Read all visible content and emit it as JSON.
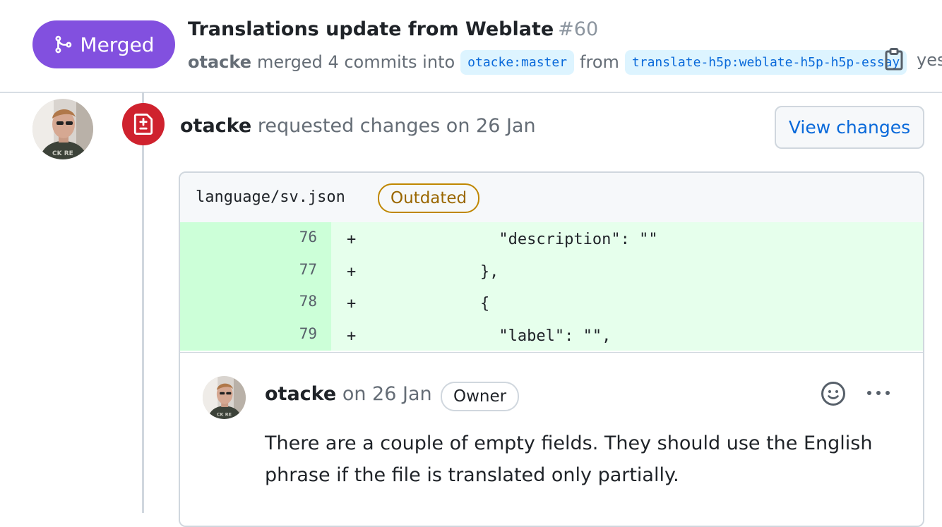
{
  "header": {
    "status_label": "Merged",
    "title": "Translations update from Weblate",
    "number": "#60",
    "merger": "otacke",
    "merged_text": "merged 4 commits into",
    "base_branch": "otacke:master",
    "from_text": "from",
    "head_branch": "translate-h5p:weblate-h5p-h5p-essay",
    "trailing_text": "yes"
  },
  "review": {
    "author": "otacke",
    "action": "requested changes on 26 Jan",
    "view_changes_label": "View changes"
  },
  "file": {
    "name": "language/sv.json",
    "badge": "Outdated",
    "lines": [
      {
        "num": "76",
        "sign": "+",
        "code": "              \"description\": \"\""
      },
      {
        "num": "77",
        "sign": "+",
        "code": "            },"
      },
      {
        "num": "78",
        "sign": "+",
        "code": "            {"
      },
      {
        "num": "79",
        "sign": "+",
        "code": "              \"label\": \"\","
      }
    ]
  },
  "comment": {
    "author": "otacke",
    "date_text": "on 26 Jan",
    "role_badge": "Owner",
    "body": "There are a couple of empty fields. They should use the English phrase if the file is translated only partially."
  },
  "colors": {
    "merged": "#8250df",
    "changes_requested": "#cf222e",
    "link": "#0969da",
    "addition_bg": "#e6ffec",
    "addition_num_bg": "#ccffd8",
    "outdated": "#9a6700"
  }
}
